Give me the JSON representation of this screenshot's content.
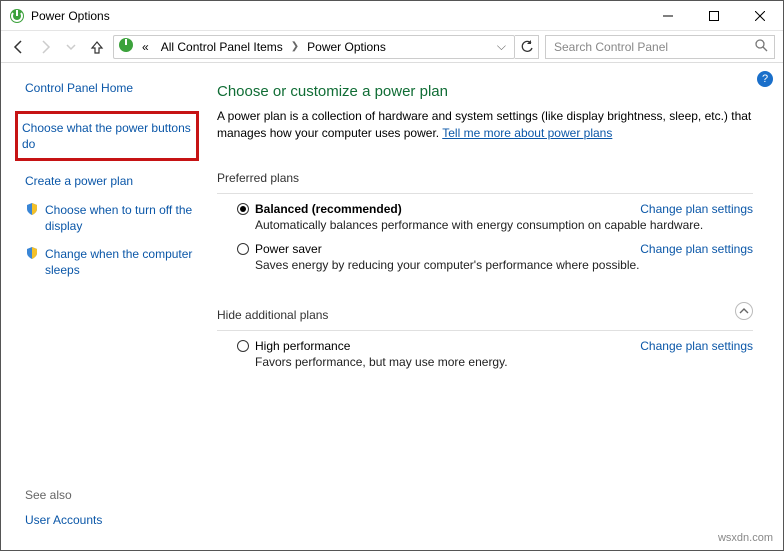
{
  "window": {
    "title": "Power Options"
  },
  "breadcrumb": {
    "ellipsis": "«",
    "items": [
      "All Control Panel Items",
      "Power Options"
    ]
  },
  "search": {
    "placeholder": "Search Control Panel"
  },
  "sidebar": {
    "home": "Control Panel Home",
    "items": [
      "Choose what the power buttons do",
      "Create a power plan",
      "Choose when to turn off the display",
      "Change when the computer sleeps"
    ],
    "see_also": "See also",
    "see_links": [
      "User Accounts"
    ]
  },
  "main": {
    "heading": "Choose or customize a power plan",
    "description": "A power plan is a collection of hardware and system settings (like display brightness, sleep, etc.) that manages how your computer uses power.",
    "more_link": "Tell me more about power plans",
    "preferred_label": "Preferred plans",
    "hide_label": "Hide additional plans",
    "change_link": "Change plan settings",
    "plans_preferred": [
      {
        "name": "Balanced (recommended)",
        "selected": true,
        "desc": "Automatically balances performance with energy consumption on capable hardware."
      },
      {
        "name": "Power saver",
        "selected": false,
        "desc": "Saves energy by reducing your computer's performance where possible."
      }
    ],
    "plans_additional": [
      {
        "name": "High performance",
        "selected": false,
        "desc": "Favors performance, but may use more energy."
      }
    ]
  },
  "watermark": "wsxdn.com"
}
